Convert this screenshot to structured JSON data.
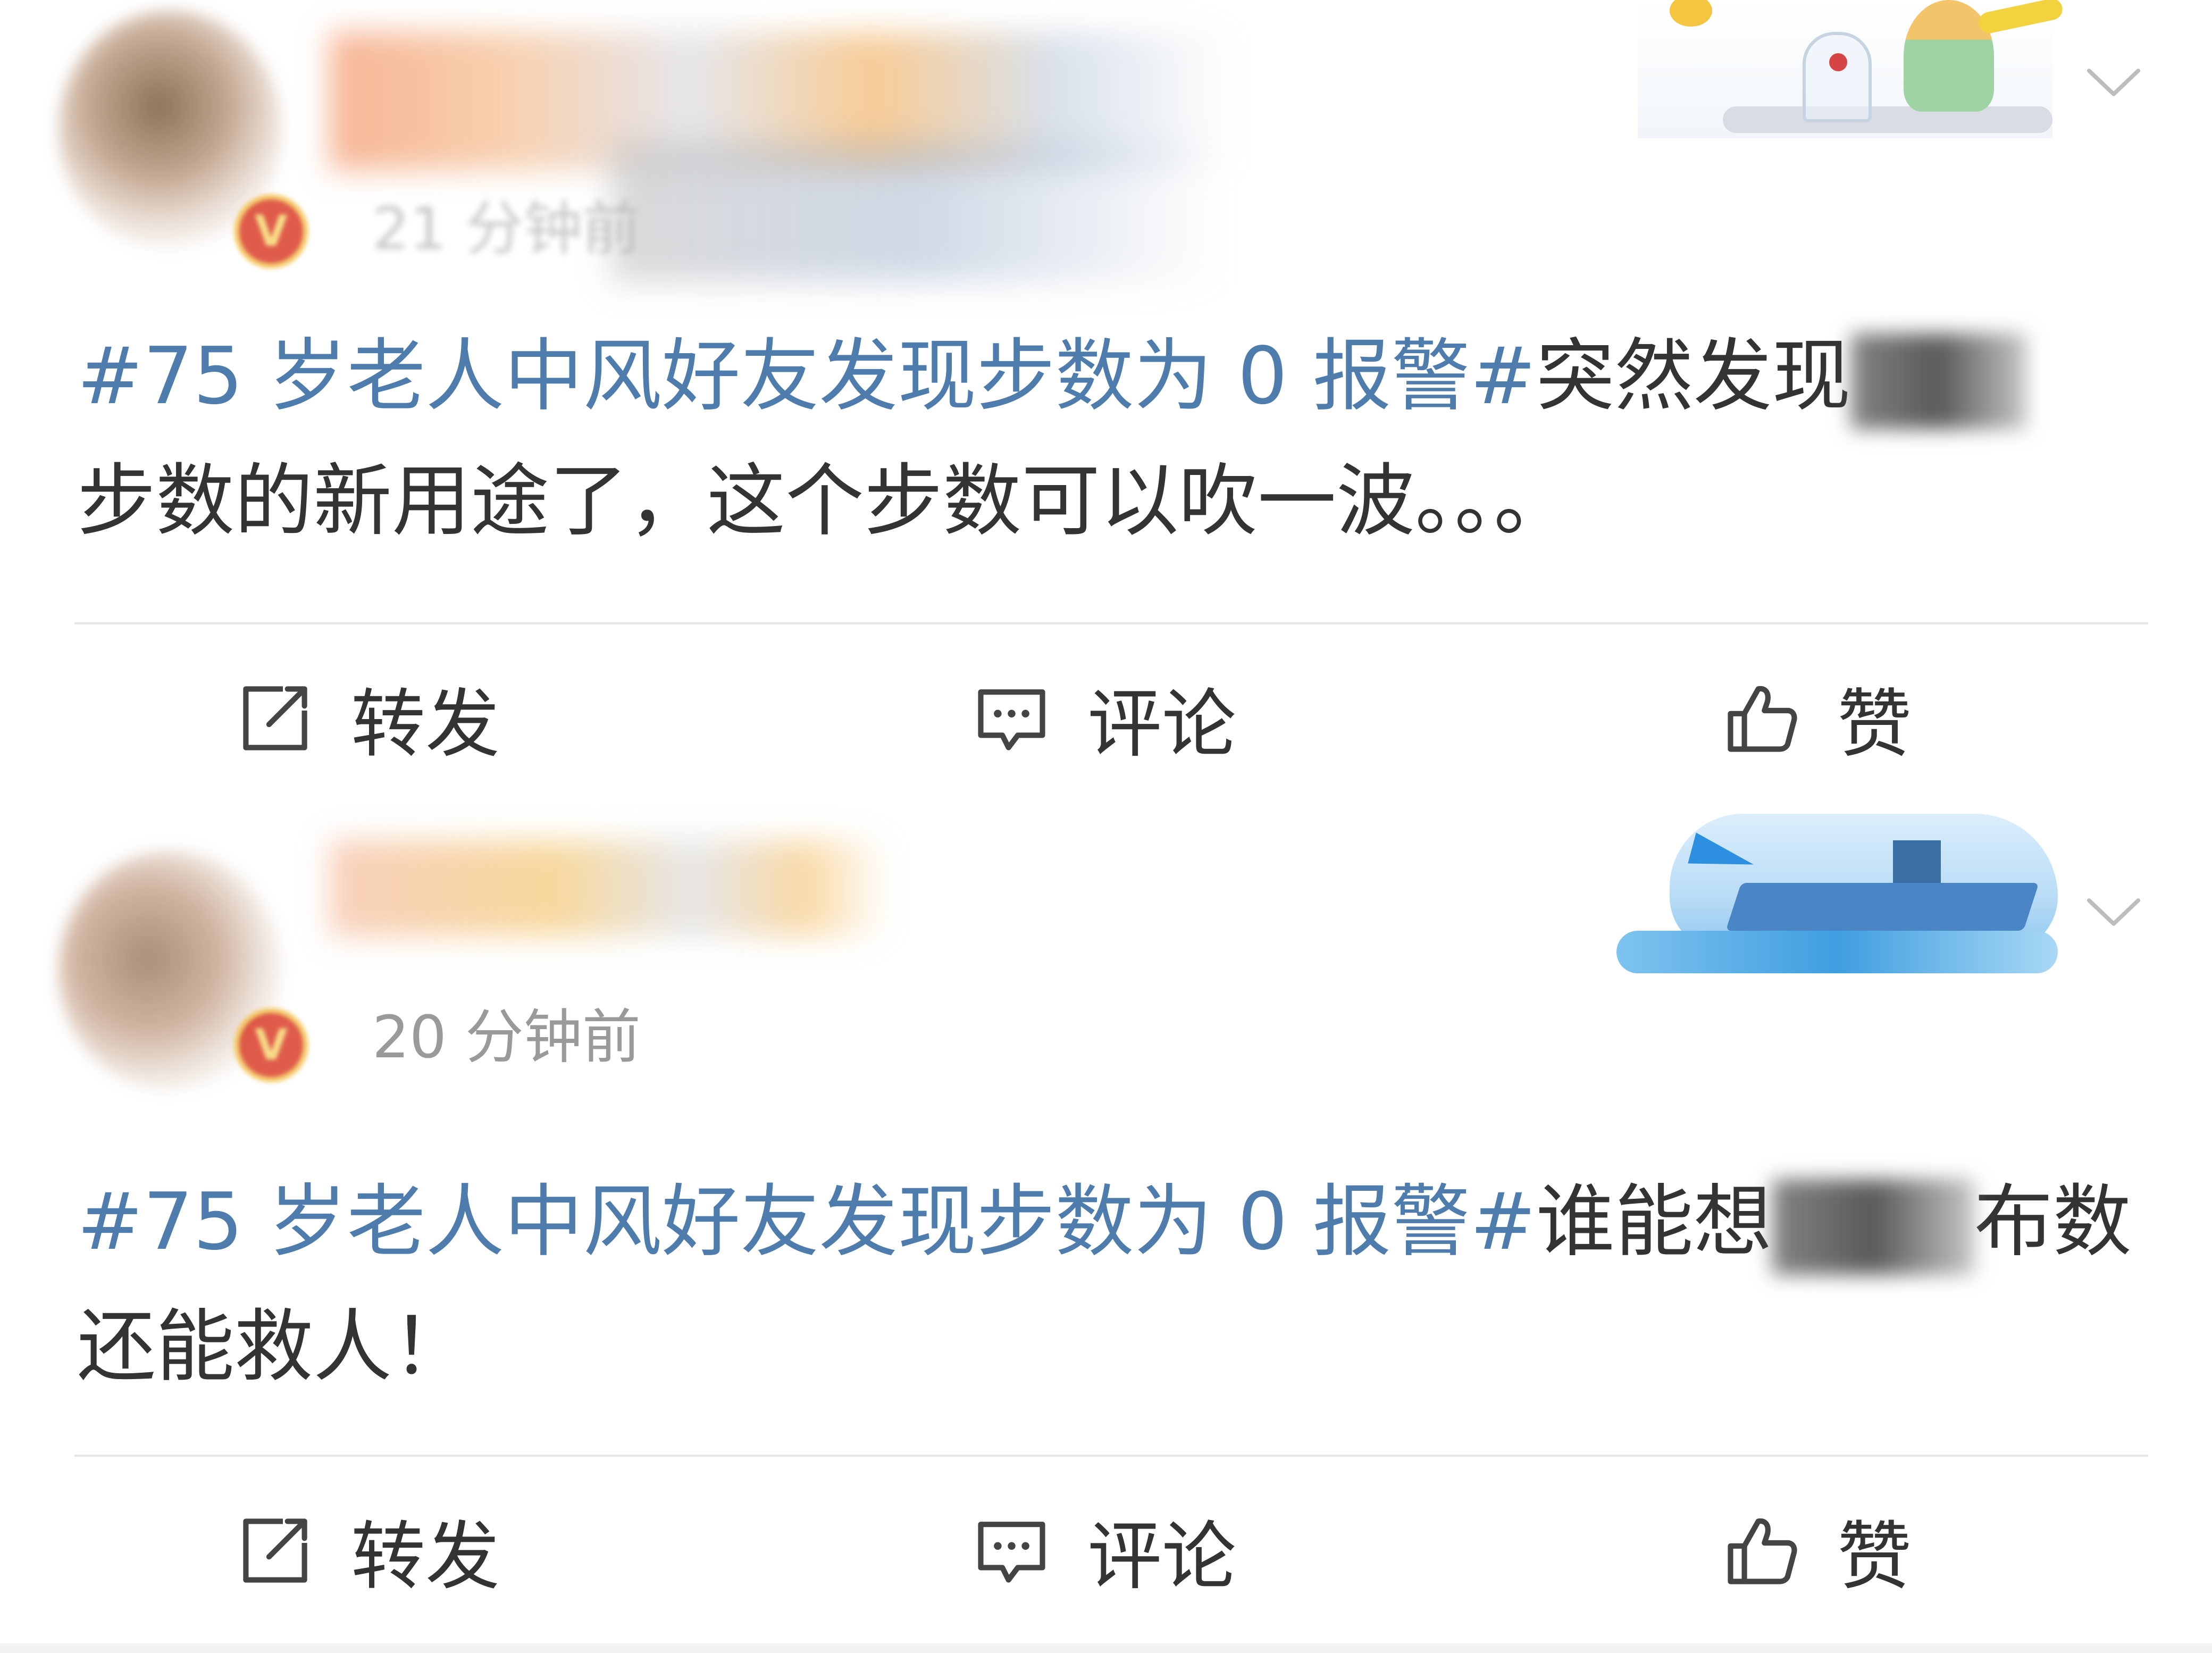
{
  "posts": [
    {
      "time": "21 分钟前",
      "hashtag": "#75 岁老人中风好友发现步数为 0 报警#",
      "text_before_redact": "突然发现",
      "text_after_redact": "步数的新用途了，这个步数可以吹一波。。。",
      "actions": {
        "repost": "转发",
        "comment": "评论",
        "like": "赞"
      }
    },
    {
      "time": "20 分钟前",
      "hashtag": "#75 岁老人中风好友发现步数为 0 报警#",
      "text_before_redact": "谁能想",
      "text_after_redact": "布数还能救人！",
      "actions": {
        "repost": "转发",
        "comment": "评论",
        "like": "赞"
      }
    }
  ],
  "icons": {
    "repost": "repost-icon",
    "comment": "comment-icon",
    "like": "like-icon",
    "more": "chevron-down-icon",
    "verified": "verified-badge-icon"
  },
  "colors": {
    "hashtag": "#4e7cad",
    "text": "#333333",
    "muted": "#9a9a9a",
    "divider": "#e6e6e6"
  }
}
